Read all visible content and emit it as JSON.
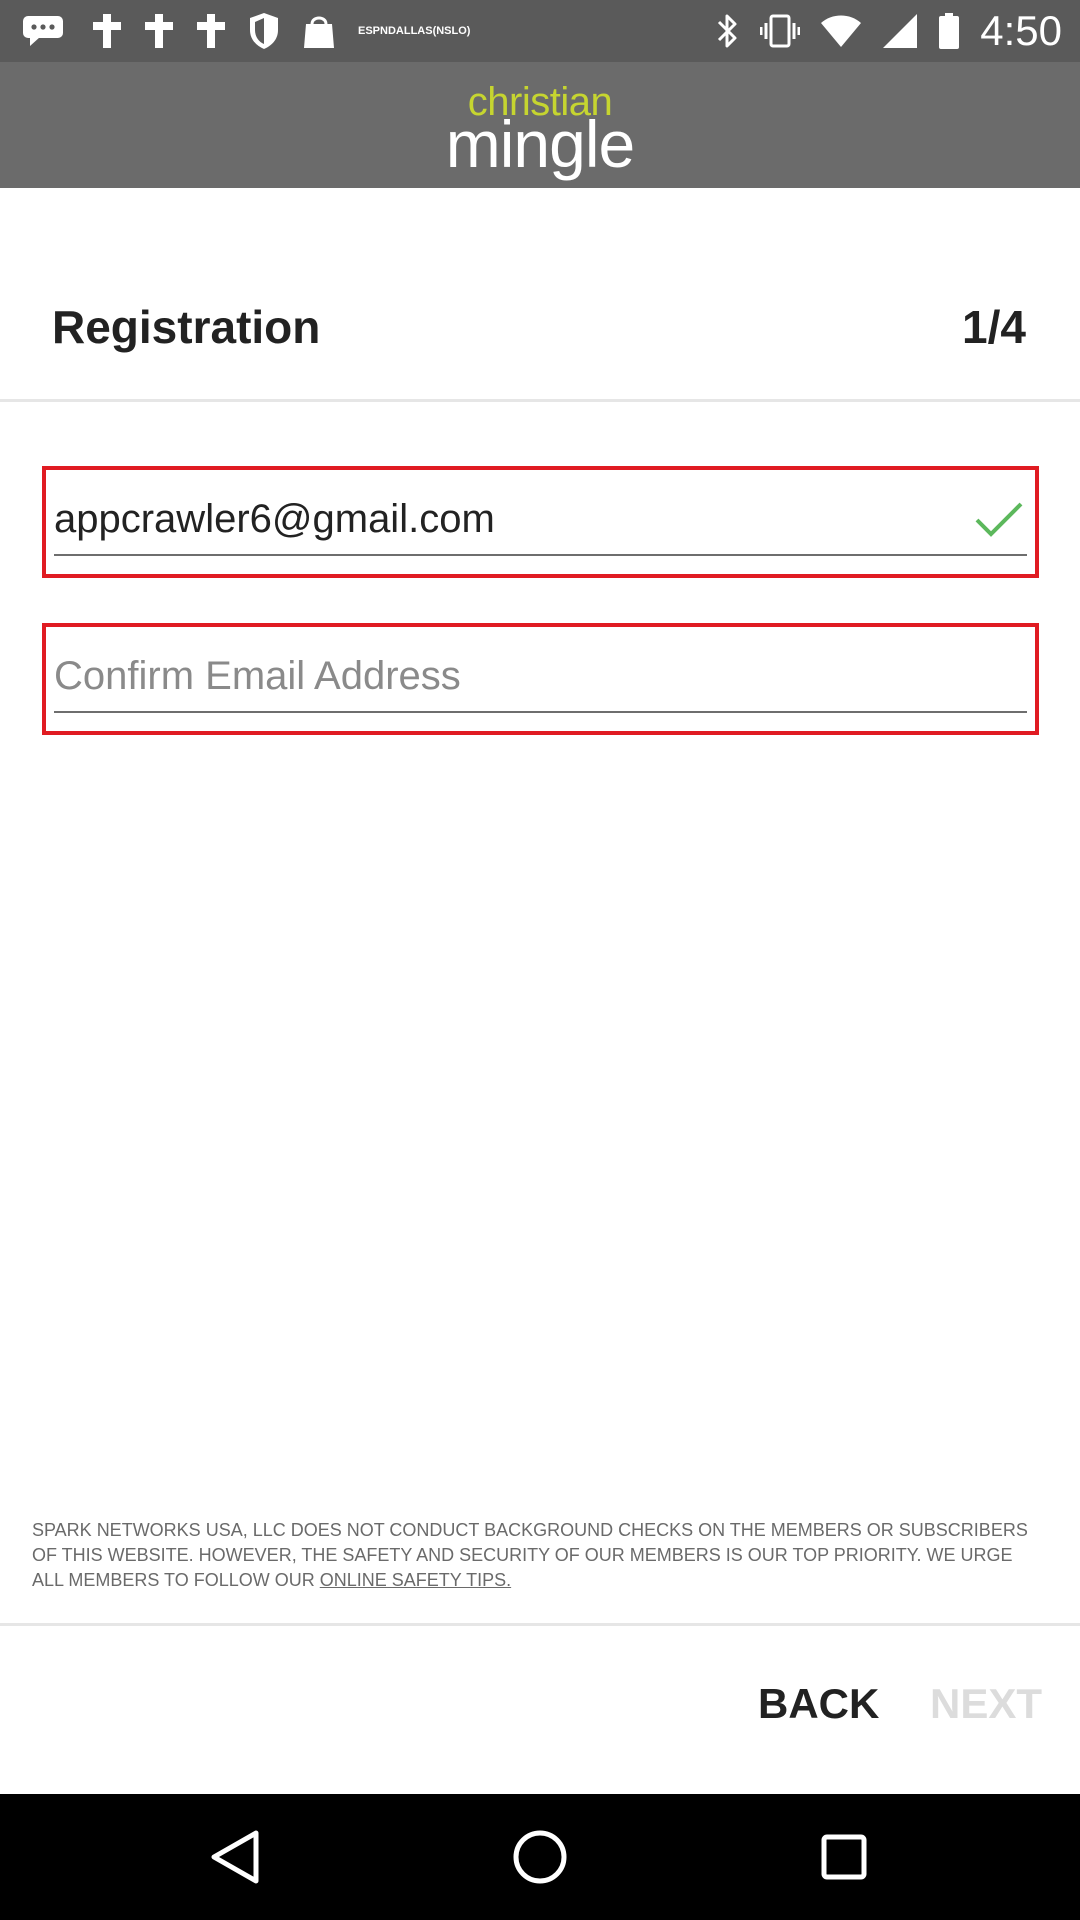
{
  "status_bar": {
    "time": "4:50",
    "notification_icons": [
      "chat-bubbles-icon",
      "cross-icon",
      "cross-icon",
      "cross-icon",
      "shield-icon",
      "shopping-bag-icon",
      "espn-dallas-icon"
    ],
    "espn_badge_lines": [
      "ESPN",
      "DALLAS",
      "(NSLO)"
    ],
    "system_icons": [
      "bluetooth-icon",
      "vibrate-icon",
      "wifi-icon",
      "signal-icon",
      "battery-icon"
    ]
  },
  "header": {
    "logo_top": "christian",
    "logo_bottom": "mingle"
  },
  "registration": {
    "title": "Registration",
    "step": "1/4"
  },
  "email_field": {
    "value": "appcrawler6@gmail.com",
    "status_icon": "checkmark-icon"
  },
  "confirm_email_field": {
    "value": "",
    "placeholder": "Confirm Email Address"
  },
  "disclaimer": {
    "text": "SPARK NETWORKS USA, LLC DOES NOT CONDUCT BACKGROUND CHECKS ON THE MEMBERS OR SUBSCRIBERS OF THIS WEBSITE. HOWEVER, THE SAFETY AND SECURITY OF OUR MEMBERS IS OUR TOP PRIORITY. WE URGE ALL MEMBERS TO FOLLOW OUR ",
    "link": "ONLINE SAFETY TIPS."
  },
  "buttons": {
    "back_label": "BACK",
    "next_label": "NEXT"
  },
  "nav_bar": {
    "icons": [
      "back-triangle-icon",
      "home-circle-icon",
      "recents-square-icon"
    ]
  },
  "colors": {
    "status_bar_bg": "#5a5a5a",
    "header_bg": "#6b6b6b",
    "logo_accent": "#c6d530",
    "field_border": "#e01b22",
    "check_green": "#5cb85c",
    "next_disabled": "#dcdcdc"
  }
}
